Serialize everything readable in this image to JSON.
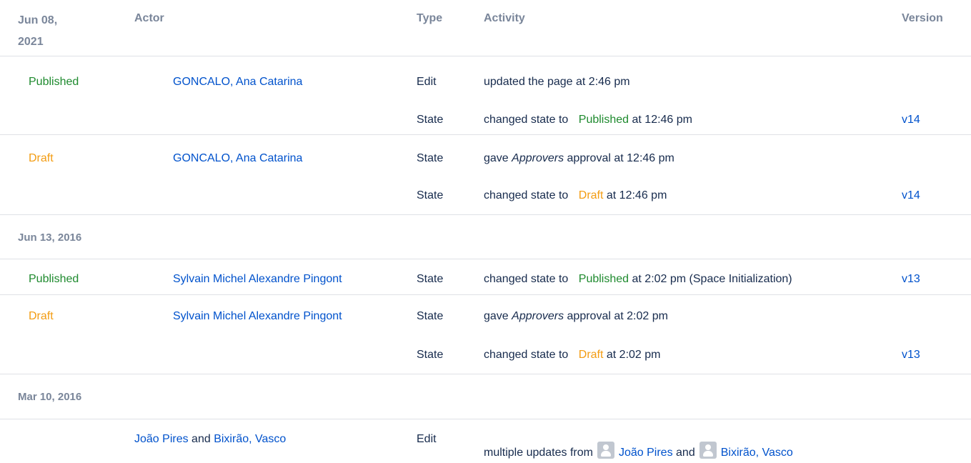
{
  "header": {
    "date": "Jun 08,\n2021",
    "actor": "Actor",
    "type": "Type",
    "activity": "Activity",
    "version": "Version"
  },
  "groups": [
    {
      "date": "Jun 08, 2021",
      "rows": [
        {
          "state": "Published",
          "actor": "GONCALO, Ana Catarina",
          "type": "Edit",
          "activity_prefix": "updated the page at 2:46 pm",
          "version": ""
        },
        {
          "state": "",
          "actor": "",
          "type": "State",
          "activity_prefix": "changed state to",
          "activity_state": "Published",
          "activity_suffix": "at 12:46 pm",
          "version": "v14"
        },
        {
          "state": "Draft",
          "actor": "GONCALO, Ana Catarina",
          "type": "State",
          "activity_prefix": "gave",
          "activity_italic": "Approvers",
          "activity_suffix": "approval at 12:46 pm",
          "version": ""
        },
        {
          "state": "",
          "actor": "",
          "type": "State",
          "activity_prefix": "changed state to",
          "activity_state": "Draft",
          "activity_suffix": "at 12:46 pm",
          "version": "v14"
        }
      ]
    },
    {
      "date": "Jun 13, 2016",
      "rows": [
        {
          "state": "Published",
          "actor": "Sylvain Michel Alexandre Pingont",
          "type": "State",
          "activity_prefix": "changed state to",
          "activity_state": "Published",
          "activity_suffix": "at 2:02 pm (Space Initialization)",
          "version": "v13"
        },
        {
          "state": "Draft",
          "actor": "Sylvain Michel Alexandre Pingont",
          "type": "State",
          "activity_prefix": "gave",
          "activity_italic": "Approvers",
          "activity_suffix": "approval at 2:02 pm",
          "version": ""
        },
        {
          "state": "",
          "actor": "",
          "type": "State",
          "activity_prefix": "changed state to",
          "activity_state": "Draft",
          "activity_suffix": "at 2:02 pm",
          "version": "v13"
        }
      ]
    },
    {
      "date": "Mar 10, 2016",
      "rows": [
        {
          "state": "",
          "actor_1": "João Pires",
          "actor_and": "and",
          "actor_2": "Bixirão, Vasco",
          "type": "Edit",
          "activity_prefix": "multiple updates from",
          "activity_user_1": "João Pires",
          "activity_and": "and",
          "activity_user_2": "Bixirão, Vasco",
          "version": ""
        }
      ]
    }
  ],
  "colors": {
    "link": "#0052cc",
    "published": "#1e8a2e",
    "draft": "#f39c12",
    "header": "#7a869a",
    "divider": "#dfe1e6"
  },
  "icons": {
    "avatar": "user-avatar-icon"
  }
}
